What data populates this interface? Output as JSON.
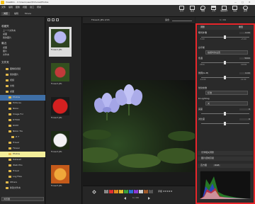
{
  "title_bar": {
    "title": "ViewNX-i - C:\\Users\\user\\Pictures\\Photos",
    "controls": [
      "—",
      "□",
      "✕"
    ]
  },
  "menu": [
    "文件",
    "编辑",
    "图像",
    "视图",
    "窗口",
    "帮助"
  ],
  "mode_tabs": [
    "浏览",
    "编辑",
    "Movie"
  ],
  "toolbar": {
    "actions": [
      {
        "label": "打印",
        "icon": "print-icon"
      },
      {
        "label": "发送",
        "icon": "send-icon"
      },
      {
        "label": "地图",
        "icon": "map-icon"
      },
      {
        "label": "上传",
        "icon": "upload-icon"
      },
      {
        "label": "编辑软件",
        "icon": "edit-software-icon"
      },
      {
        "label": "动画",
        "icon": "movie-icon"
      },
      {
        "label": "其他",
        "icon": "more-icon"
      }
    ],
    "image_adjust_label": "图像 ABC",
    "page_counter": "1 / 16"
  },
  "left_panel": {
    "favorites_header": "收藏夹",
    "favorites": [
      "上一个文件夹",
      "桌面",
      "我的图片"
    ],
    "recent_header": "最近",
    "recent": [
      "桌面",
      "图片",
      "文件夹"
    ],
    "browser_header": "文件夹",
    "tree": [
      {
        "label": "图像和视频",
        "indent": 2
      },
      {
        "label": "我的图片",
        "indent": 2
      },
      {
        "label": "视频",
        "indent": 2
      },
      {
        "label": "文档",
        "indent": 2
      },
      {
        "label": "桌面",
        "indent": 2
      },
      {
        "label": "Photos",
        "indent": 3,
        "selected": true
      },
      {
        "label": "Pictures",
        "indent": 3
      },
      {
        "label": "Nikon",
        "indent": 3
      },
      {
        "label": "Image Fol",
        "indent": 3
      },
      {
        "label": "D7500",
        "indent": 3
      },
      {
        "label": "DCIM",
        "indent": 3
      },
      {
        "label": "Nikon Tra",
        "indent": 3
      },
      {
        "label": "Z 7",
        "indent": 4
      },
      {
        "label": "Travel",
        "indent": 3
      },
      {
        "label": "Flower",
        "indent": 3
      },
      {
        "label": "Photos",
        "indent": 3,
        "highlight": true
      },
      {
        "label": "Dataset",
        "indent": 3
      },
      {
        "label": "Walk Pho",
        "indent": 3
      },
      {
        "label": "Travel",
        "indent": 3
      },
      {
        "label": "Log Files",
        "indent": 3
      },
      {
        "label": "Others",
        "indent": 2
      },
      {
        "label": "新建文件夹",
        "indent": 2
      }
    ],
    "bottom_select": "浏览器"
  },
  "thumbnails": [
    {
      "caption": "Flower1.JPG",
      "selected": true
    },
    {
      "caption": "Flower2.JPG"
    },
    {
      "caption": "Flower3.JPG"
    },
    {
      "caption": "Flower4.JPG"
    },
    {
      "caption": "Flower5.JPG"
    }
  ],
  "viewer": {
    "file_info": "Flower1.JPG 2/16",
    "zoom_label": "适合",
    "page_indicator": "1 / 16",
    "rating_label": "评级 ★★★★★",
    "color_labels": [
      "0",
      "1",
      "2",
      "3",
      "4",
      "5",
      "6",
      "7",
      "8",
      "9"
    ]
  },
  "adjust_panel": {
    "tab_label": "调整",
    "reset_label": "重置",
    "sections": [
      {
        "title": "曝光补偿",
        "value": "0.00",
        "min": "-5.00",
        "max": "+5.00"
      },
      {
        "title": "白平衡",
        "value": "拍摄时的设置",
        "dropdown": true
      },
      {
        "title": "色温",
        "value": "5000",
        "min": "2500",
        "max": "10000"
      },
      {
        "title": "微调(G-M)",
        "value": "0.00",
        "min": "-12.00",
        "max": "12.00"
      },
      {
        "title": "优化校准",
        "value": "标准",
        "dropdown": true
      },
      {
        "title": "D-Lighting",
        "value": "关",
        "dropdown": true
      },
      {
        "title": "亮度",
        "value": "0"
      },
      {
        "title": "对比度",
        "value": "0"
      }
    ],
    "collapsed": [
      "光学相关调整",
      "图片控制高级"
    ],
    "histogram_label": "直方图",
    "histogram_mode": "RGB"
  },
  "colors": {
    "accent": "#e6c030",
    "highlight_border": "#e8262a",
    "selected_folder": "#3f6fa6",
    "panel_bg": "#2a2a2a"
  }
}
